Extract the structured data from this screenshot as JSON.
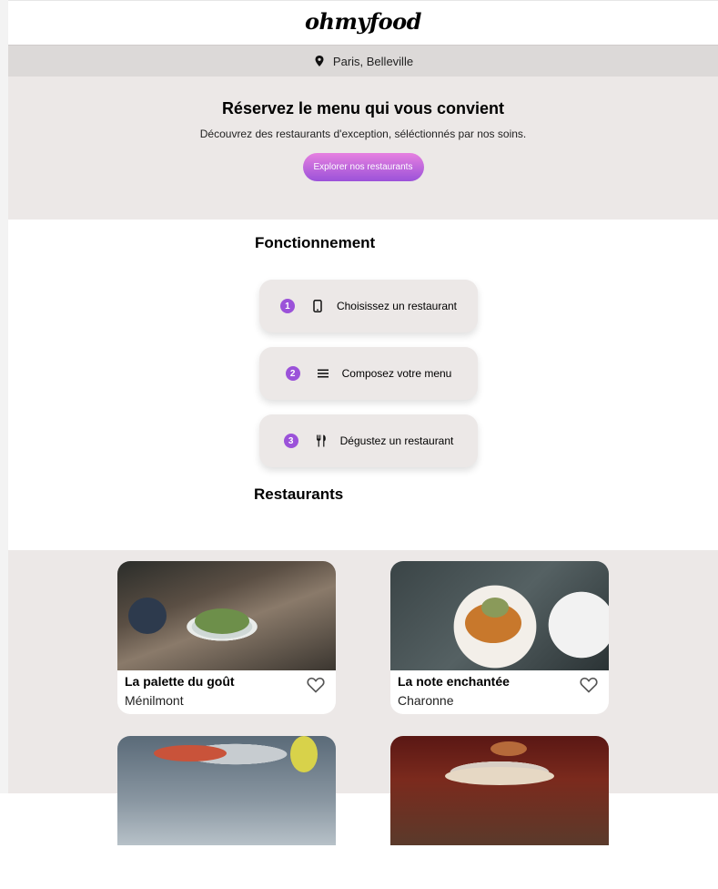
{
  "header": {
    "logo_text": "ohmyfood"
  },
  "location": {
    "text": "Paris, Belleville",
    "icon": "map-pin-icon"
  },
  "hero": {
    "title": "Réservez le menu qui vous convient",
    "subtitle": "Découvrez des restaurants d'exception, séléctionnés par nos soins.",
    "cta_label": "Explorer nos restaurants"
  },
  "how": {
    "title": "Fonctionnement",
    "steps": [
      {
        "number": "1",
        "icon": "phone-icon",
        "label": "Choisissez un restaurant"
      },
      {
        "number": "2",
        "icon": "list-icon",
        "label": "Composez votre menu"
      },
      {
        "number": "3",
        "icon": "utensils-icon",
        "label": "Dégustez un restaurant"
      }
    ]
  },
  "restaurants": {
    "title": "Restaurants",
    "cards": [
      {
        "name": "La palette du goût",
        "area": "Ménilmont"
      },
      {
        "name": "La note enchantée",
        "area": "Charonne"
      },
      {
        "name": "",
        "area": ""
      },
      {
        "name": "",
        "area": ""
      }
    ]
  },
  "colors": {
    "accent": "#9b52d9",
    "accent_light": "#e680e0",
    "background": "#ece8e7",
    "location_bar": "#dcd9d8"
  }
}
